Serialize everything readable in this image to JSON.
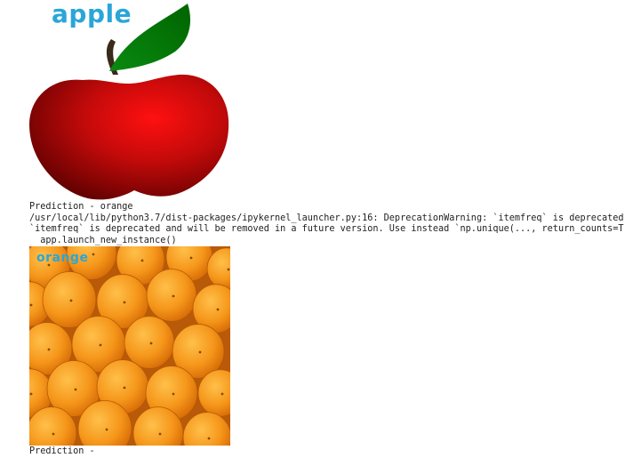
{
  "outputs": [
    {
      "image": {
        "label_text": "apple",
        "subject": "red apple with green leaf and brown stem",
        "colors": {
          "label": "#2aa6d8",
          "apple": "#c00000",
          "leaf": "#008000",
          "stem": "#3a2a1a"
        }
      },
      "prediction_text": "Prediction - orange",
      "warning_lines": [
        "/usr/local/lib/python3.7/dist-packages/ipykernel_launcher.py:16: DeprecationWarning: `itemfreq` is deprecated!",
        "`itemfreq` is deprecated and will be removed in a future version. Use instead `np.unique(..., return_counts=True)`",
        "  app.launch_new_instance()"
      ]
    },
    {
      "image": {
        "label_text": "orange",
        "subject": "pile of oranges",
        "colors": {
          "label": "#2aa6d8",
          "orange": "#f5961a"
        }
      },
      "prediction_text": "Prediction - "
    }
  ]
}
